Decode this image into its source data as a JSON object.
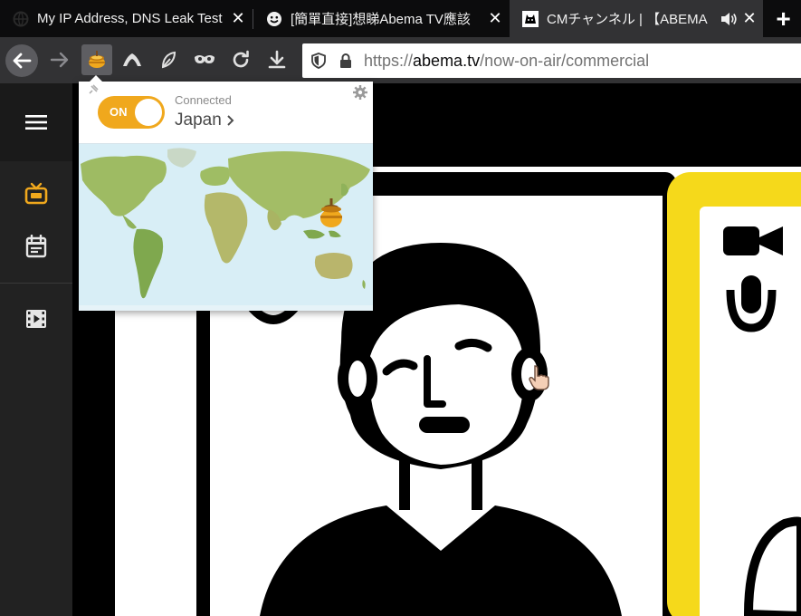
{
  "tabs": [
    {
      "title": "My IP Address, DNS Leak Test",
      "favicon": "globe-icon",
      "active": false
    },
    {
      "title": "[簡單直接]想睇Abema TV應該",
      "favicon": "smiley-icon",
      "active": false
    },
    {
      "title": "CMチャンネル | 【ABEMA",
      "favicon": "abema-icon",
      "active": true,
      "audio": true
    }
  ],
  "toolbar": {
    "url_scheme": "https://",
    "url_host": "abema.tv",
    "url_path": "/now-on-air/commercial"
  },
  "vpn_popup": {
    "toggle_label": "ON",
    "status": "Connected",
    "country": "Japan"
  },
  "sidebar": {
    "items": [
      {
        "icon": "tv-icon",
        "active": true
      },
      {
        "icon": "calendar-icon",
        "active": false
      },
      {
        "icon": "film-icon",
        "active": false
      }
    ]
  },
  "colors": {
    "accent": "#f0a81d",
    "tab_active": "#323234",
    "tabstrip": "#0c0c0d",
    "sidebar": "#222222",
    "yellow_frame": "#f5d91b"
  }
}
